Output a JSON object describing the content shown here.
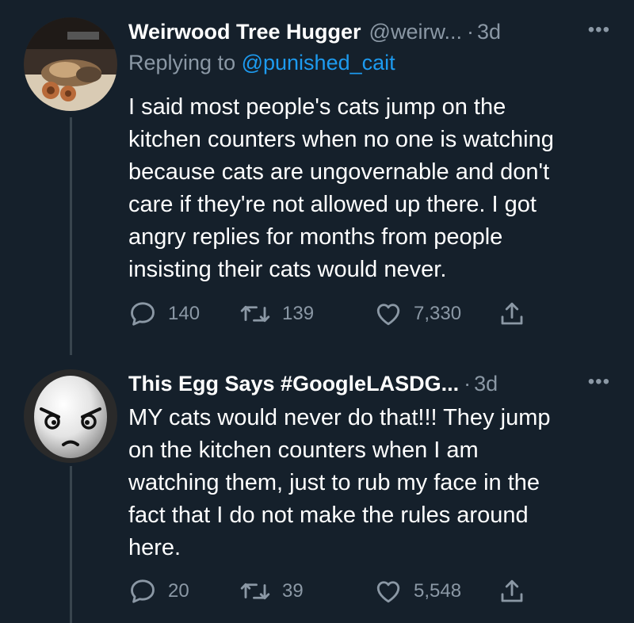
{
  "tweets": [
    {
      "display_name": "Weirwood Tree Hugger",
      "handle": "@weirw...",
      "dot": "·",
      "time": "3d",
      "more": "•••",
      "replying_prefix": "Replying to ",
      "replying_to": "@punished_cait",
      "text_lines": [
        "I said most people's cats jump on the",
        "kitchen counters when no one is watching",
        "because cats are ungovernable and don't",
        "care if they're not allowed up there.  I got",
        "angry replies for months from people",
        "insisting their cats would never."
      ],
      "replies": "140",
      "retweets": "139",
      "likes": "7,330",
      "icons": {
        "reply": "reply-icon",
        "retweet": "retweet-icon",
        "like": "heart-icon",
        "share": "share-icon"
      }
    },
    {
      "display_name": "This Egg Says #GoogleLASDG...",
      "dot": "·",
      "time": "3d",
      "more": "•••",
      "text_lines": [
        "MY cats would never do that!!! They jump",
        "on the kitchen counters when I am",
        "watching them, just to rub my face in the",
        "fact that I do not make the rules around",
        "here."
      ],
      "replies": "20",
      "retweets": "39",
      "likes": "5,548",
      "icons": {
        "reply": "reply-icon",
        "retweet": "retweet-icon",
        "like": "heart-icon",
        "share": "share-icon"
      }
    }
  ],
  "colors": {
    "background": "#15202b",
    "text_primary": "#ffffff",
    "text_secondary": "#8b98a5",
    "link": "#1d9bf0",
    "thread_line": "#38444d"
  }
}
